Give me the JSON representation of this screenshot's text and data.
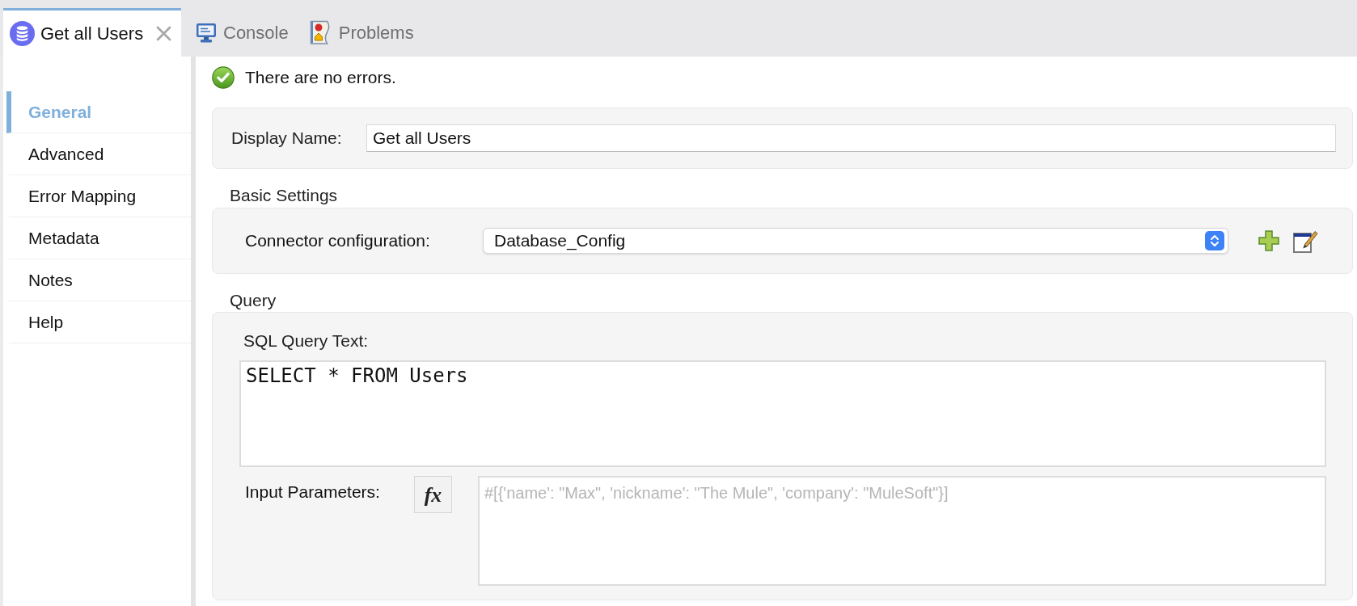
{
  "tabs": [
    {
      "label": "Get all Users",
      "kind": "editor",
      "selected": true,
      "closable": true
    },
    {
      "label": "Console",
      "kind": "console",
      "selected": false,
      "closable": false
    },
    {
      "label": "Problems",
      "kind": "problems",
      "selected": false,
      "closable": false
    }
  ],
  "sidebar": {
    "items": [
      {
        "label": "General",
        "selected": true
      },
      {
        "label": "Advanced",
        "selected": false
      },
      {
        "label": "Error Mapping",
        "selected": false
      },
      {
        "label": "Metadata",
        "selected": false
      },
      {
        "label": "Notes",
        "selected": false
      },
      {
        "label": "Help",
        "selected": false
      }
    ]
  },
  "status": {
    "kind": "ok",
    "message": "There are no errors."
  },
  "general": {
    "display_name": {
      "label": "Display Name:",
      "value": "Get all Users"
    }
  },
  "basic_settings": {
    "title": "Basic Settings",
    "connector_configuration": {
      "label": "Connector configuration:",
      "value": "Database_Config"
    }
  },
  "query": {
    "title": "Query",
    "sql_label": "SQL Query Text:",
    "sql": "SELECT * FROM Users",
    "input_parameters": {
      "label": "Input Parameters:",
      "expression_button": "fx",
      "placeholder": "#[{'name': \"Max\", 'nickname': \"The Mule\", 'company': \"MuleSoft\"}]"
    }
  }
}
